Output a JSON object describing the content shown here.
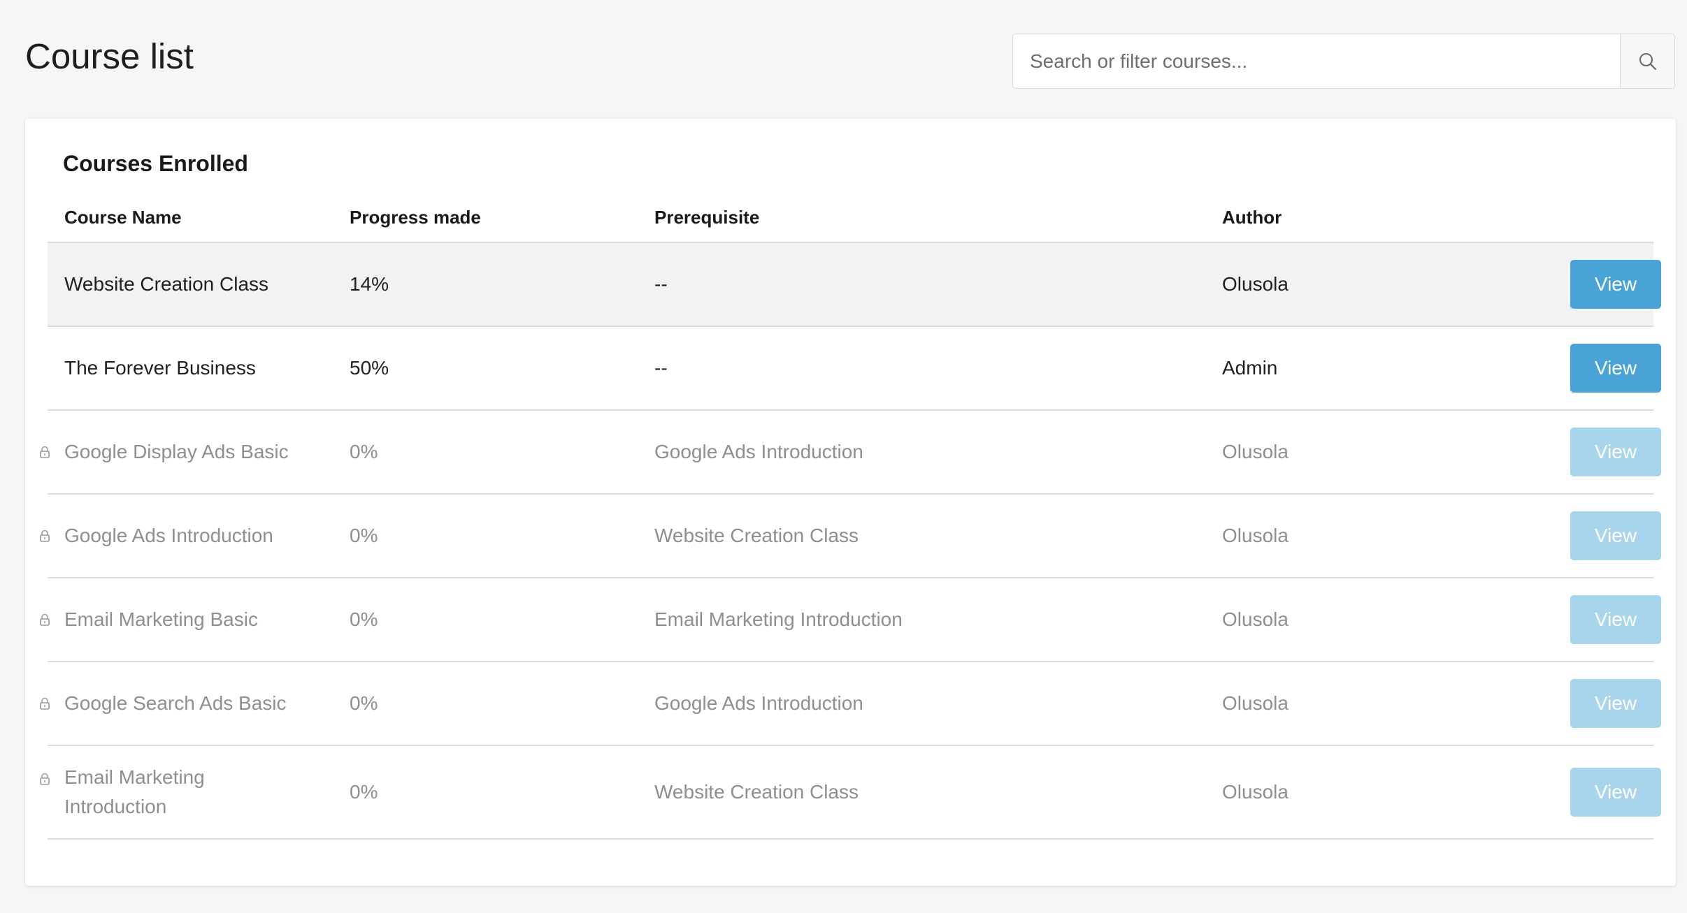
{
  "header": {
    "title": "Course list"
  },
  "search": {
    "placeholder": "Search or filter courses...",
    "icon": "search-icon"
  },
  "courses_card": {
    "title": "Courses Enrolled",
    "columns": {
      "name": "Course Name",
      "progress": "Progress made",
      "prerequisite": "Prerequisite",
      "author": "Author"
    },
    "rows": [
      {
        "name": "Website Creation Class",
        "progress": "14%",
        "prerequisite": "--",
        "author": "Olusola",
        "action": "View",
        "locked": false
      },
      {
        "name": "The Forever Business",
        "progress": "50%",
        "prerequisite": "--",
        "author": "Admin",
        "action": "View",
        "locked": false
      },
      {
        "name": "Google Display Ads Basic",
        "progress": "0%",
        "prerequisite": "Google Ads Introduction",
        "author": "Olusola",
        "action": "View",
        "locked": true
      },
      {
        "name": "Google Ads Introduction",
        "progress": "0%",
        "prerequisite": "Website Creation Class",
        "author": "Olusola",
        "action": "View",
        "locked": true
      },
      {
        "name": "Email Marketing Basic",
        "progress": "0%",
        "prerequisite": "Email Marketing Introduction",
        "author": "Olusola",
        "action": "View",
        "locked": true
      },
      {
        "name": "Google Search Ads Basic",
        "progress": "0%",
        "prerequisite": "Google Ads Introduction",
        "author": "Olusola",
        "action": "View",
        "locked": true
      },
      {
        "name": "Email Marketing Introduction",
        "progress": "0%",
        "prerequisite": "Website Creation Class",
        "author": "Olusola",
        "action": "View",
        "locked": true
      }
    ]
  },
  "colors": {
    "view_button_active": "#4aa3d6",
    "view_button_disabled": "#a8d5ec",
    "locked_text": "#8f8f8f",
    "highlight_row": "#f1f2f4"
  }
}
